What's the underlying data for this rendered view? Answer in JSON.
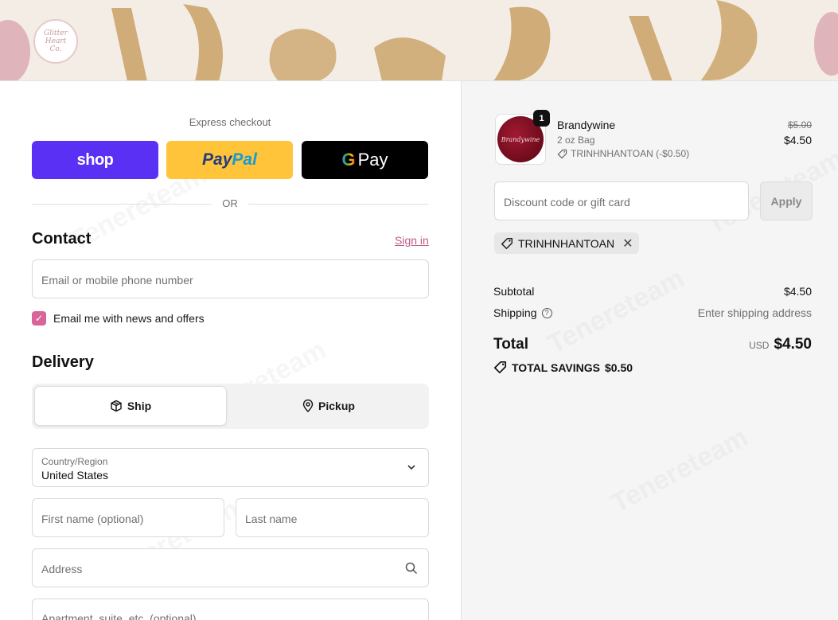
{
  "banner": {
    "logo_text": "Glitter\nHeart\nCo."
  },
  "express": {
    "label": "Express checkout",
    "shop_label": "shop",
    "paypal_part1": "Pay",
    "paypal_part2": "Pal",
    "gpay_g": "G",
    "gpay_label": "Pay",
    "or_text": "OR"
  },
  "contact": {
    "title": "Contact",
    "sign_in": "Sign in",
    "email_placeholder": "Email or mobile phone number",
    "newsletter_label": "Email me with news and offers",
    "newsletter_checked": true
  },
  "delivery": {
    "title": "Delivery",
    "ship_label": "Ship",
    "pickup_label": "Pickup",
    "country_label": "Country/Region",
    "country_value": "United States",
    "first_name_placeholder": "First name (optional)",
    "last_name_placeholder": "Last name",
    "address_placeholder": "Address",
    "apartment_placeholder": "Apartment, suite, etc. (optional)"
  },
  "order": {
    "quantity": "1",
    "product_name": "Brandywine",
    "product_image_text": "Brandywine",
    "variant": "2 oz Bag",
    "item_discount": "TRINHNHANTOAN (-$0.50)",
    "original_price": "$5.00",
    "price": "$4.50",
    "discount_placeholder": "Discount code or gift card",
    "apply_label": "Apply",
    "applied_code": "TRINHNHANTOAN",
    "remove_symbol": "✕",
    "subtotal_label": "Subtotal",
    "subtotal_value": "$4.50",
    "shipping_label": "Shipping",
    "shipping_value": "Enter shipping address",
    "total_label": "Total",
    "currency": "USD",
    "total_value": "$4.50",
    "savings_label": "TOTAL SAVINGS",
    "savings_value": "$0.50"
  },
  "colors": {
    "shop_purple": "#5a31f4",
    "paypal_yellow": "#ffc439",
    "accent_pink": "#d9649a",
    "link_pink": "#c05a86"
  }
}
